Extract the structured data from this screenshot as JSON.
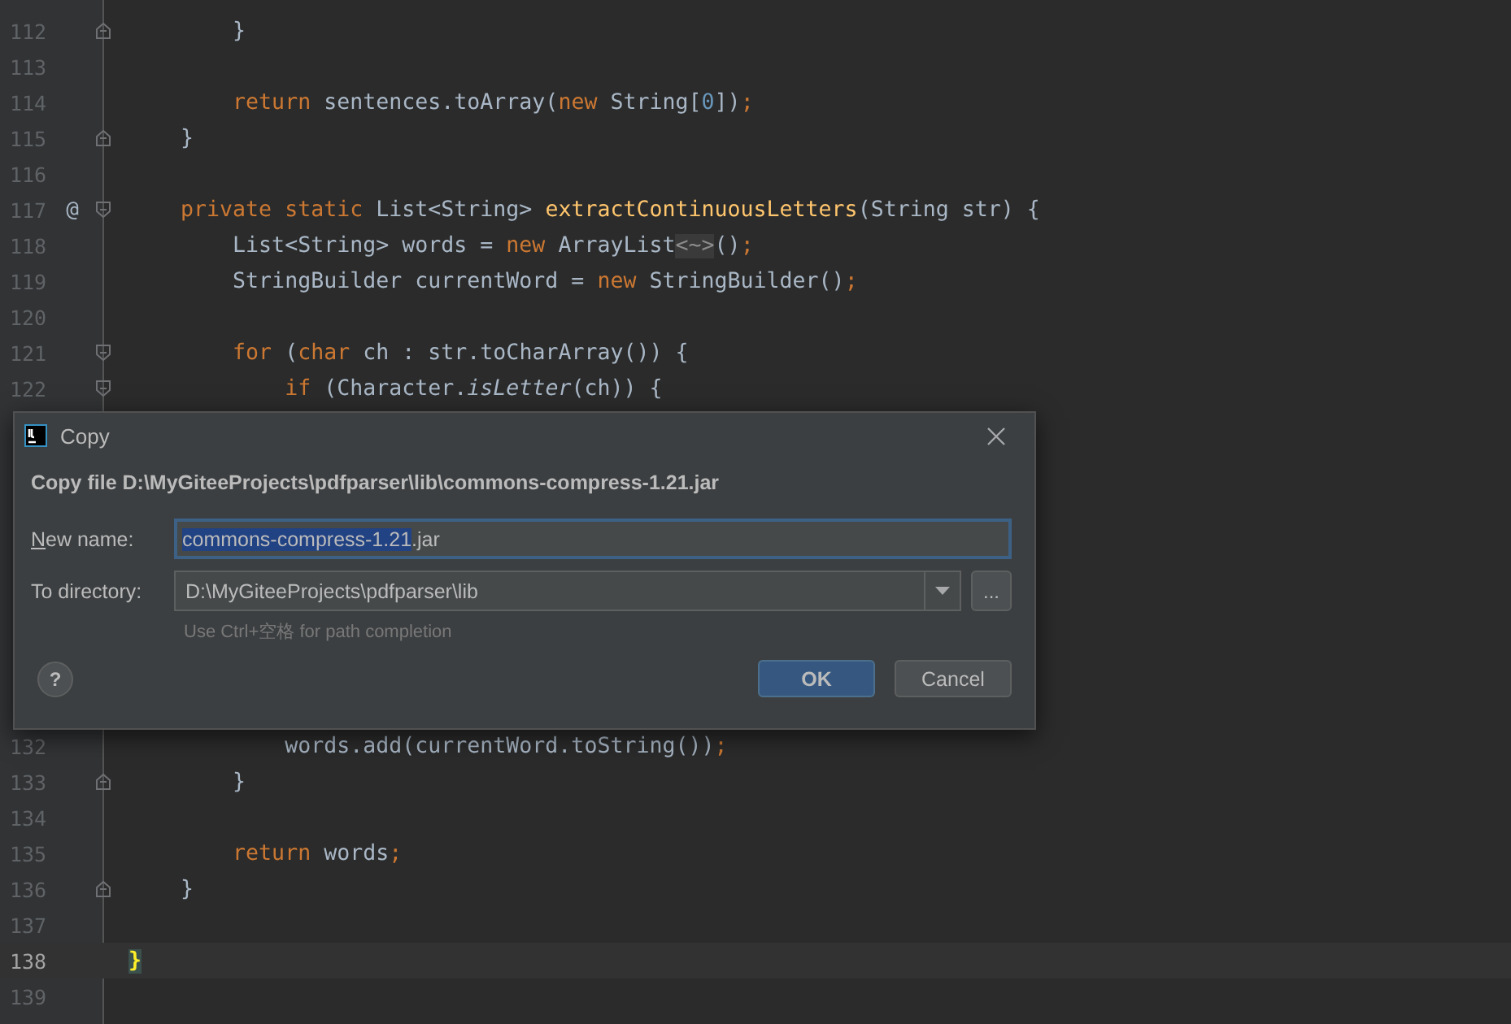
{
  "editor": {
    "lines_above": [
      {
        "number": "112",
        "current": false,
        "fold_end": true,
        "segments": [
          {
            "kind": "plain",
            "text": "        }"
          }
        ]
      },
      {
        "number": "113",
        "current": false
      },
      {
        "number": "114",
        "current": false,
        "segments": [
          {
            "kind": "keyword",
            "text": "        return "
          },
          {
            "kind": "plain",
            "text": "sentences.toArray("
          },
          {
            "kind": "keyword",
            "text": "new "
          },
          {
            "kind": "plain",
            "text": "String["
          },
          {
            "kind": "number",
            "text": "0"
          },
          {
            "kind": "plain",
            "text": "])"
          },
          {
            "kind": "keyword",
            "text": ";"
          }
        ]
      },
      {
        "number": "115",
        "current": false,
        "fold_end": true,
        "segments": [
          {
            "kind": "plain",
            "text": "    }"
          }
        ]
      },
      {
        "number": "116",
        "current": false
      },
      {
        "number": "117",
        "current": false,
        "fold_start": true,
        "annotation": "@",
        "segments": [
          {
            "kind": "keyword",
            "text": "    private static "
          },
          {
            "kind": "plain",
            "text": "List<String> "
          },
          {
            "kind": "method",
            "text": "extractContinuousLetters"
          },
          {
            "kind": "plain",
            "text": "(String str) {"
          }
        ]
      },
      {
        "number": "118",
        "current": false,
        "segments": [
          {
            "kind": "plain",
            "text": "        List<String> words = "
          },
          {
            "kind": "keyword",
            "text": "new "
          },
          {
            "kind": "plain",
            "text": "ArrayList"
          },
          {
            "kind": "folded",
            "text": "<~>"
          },
          {
            "kind": "plain",
            "text": "()"
          },
          {
            "kind": "keyword",
            "text": ";"
          }
        ]
      },
      {
        "number": "119",
        "current": false,
        "segments": [
          {
            "kind": "plain",
            "text": "        StringBuilder currentWord = "
          },
          {
            "kind": "keyword",
            "text": "new "
          },
          {
            "kind": "plain",
            "text": "StringBuilder()"
          },
          {
            "kind": "keyword",
            "text": ";"
          }
        ]
      },
      {
        "number": "120",
        "current": false
      },
      {
        "number": "121",
        "current": false,
        "fold_start": true,
        "segments": [
          {
            "kind": "keyword",
            "text": "        for "
          },
          {
            "kind": "plain",
            "text": "("
          },
          {
            "kind": "keyword",
            "text": "char "
          },
          {
            "kind": "plain",
            "text": "ch : str.toCharArray()) {"
          }
        ]
      },
      {
        "number": "122",
        "current": false,
        "fold_start": true,
        "segments": [
          {
            "kind": "keyword",
            "text": "            if "
          },
          {
            "kind": "plain",
            "text": "(Character."
          },
          {
            "kind": "italic",
            "text": "isLetter"
          },
          {
            "kind": "plain",
            "text": "(ch)) {"
          }
        ]
      }
    ],
    "lines_below": [
      {
        "number": "132",
        "current": false,
        "segments": [
          {
            "kind": "plain",
            "text": "            words.add(currentWord.toString())"
          },
          {
            "kind": "keyword",
            "text": ";"
          }
        ]
      },
      {
        "number": "133",
        "current": false,
        "fold_end": true,
        "segments": [
          {
            "kind": "plain",
            "text": "        }"
          }
        ]
      },
      {
        "number": "134",
        "current": false
      },
      {
        "number": "135",
        "current": false,
        "segments": [
          {
            "kind": "keyword",
            "text": "        return "
          },
          {
            "kind": "plain",
            "text": "words"
          },
          {
            "kind": "keyword",
            "text": ";"
          }
        ]
      },
      {
        "number": "136",
        "current": false,
        "fold_end": true,
        "segments": [
          {
            "kind": "plain",
            "text": "    }"
          }
        ]
      },
      {
        "number": "137",
        "current": false
      },
      {
        "number": "138",
        "current": true,
        "segments": [
          {
            "kind": "matched-brace",
            "text": "}"
          }
        ]
      },
      {
        "number": "139",
        "current": false
      }
    ]
  },
  "dialog": {
    "title": "Copy",
    "heading": "Copy file D:\\MyGiteeProjects\\pdfparser\\lib\\commons-compress-1.21.jar",
    "new_name": {
      "label": "New name:",
      "value_parts": [
        {
          "text": "commons-compress-1.21",
          "selected": true
        },
        {
          "text": ".jar",
          "selected": false
        }
      ]
    },
    "to_directory": {
      "label": "To directory:",
      "value": "D:\\MyGiteeProjects\\pdfparser\\lib",
      "browse": "..."
    },
    "hint": "Use Ctrl+空格 for path completion",
    "help": "?",
    "buttons": [
      {
        "label": "OK",
        "default": true
      },
      {
        "label": "Cancel",
        "default": false
      }
    ]
  }
}
